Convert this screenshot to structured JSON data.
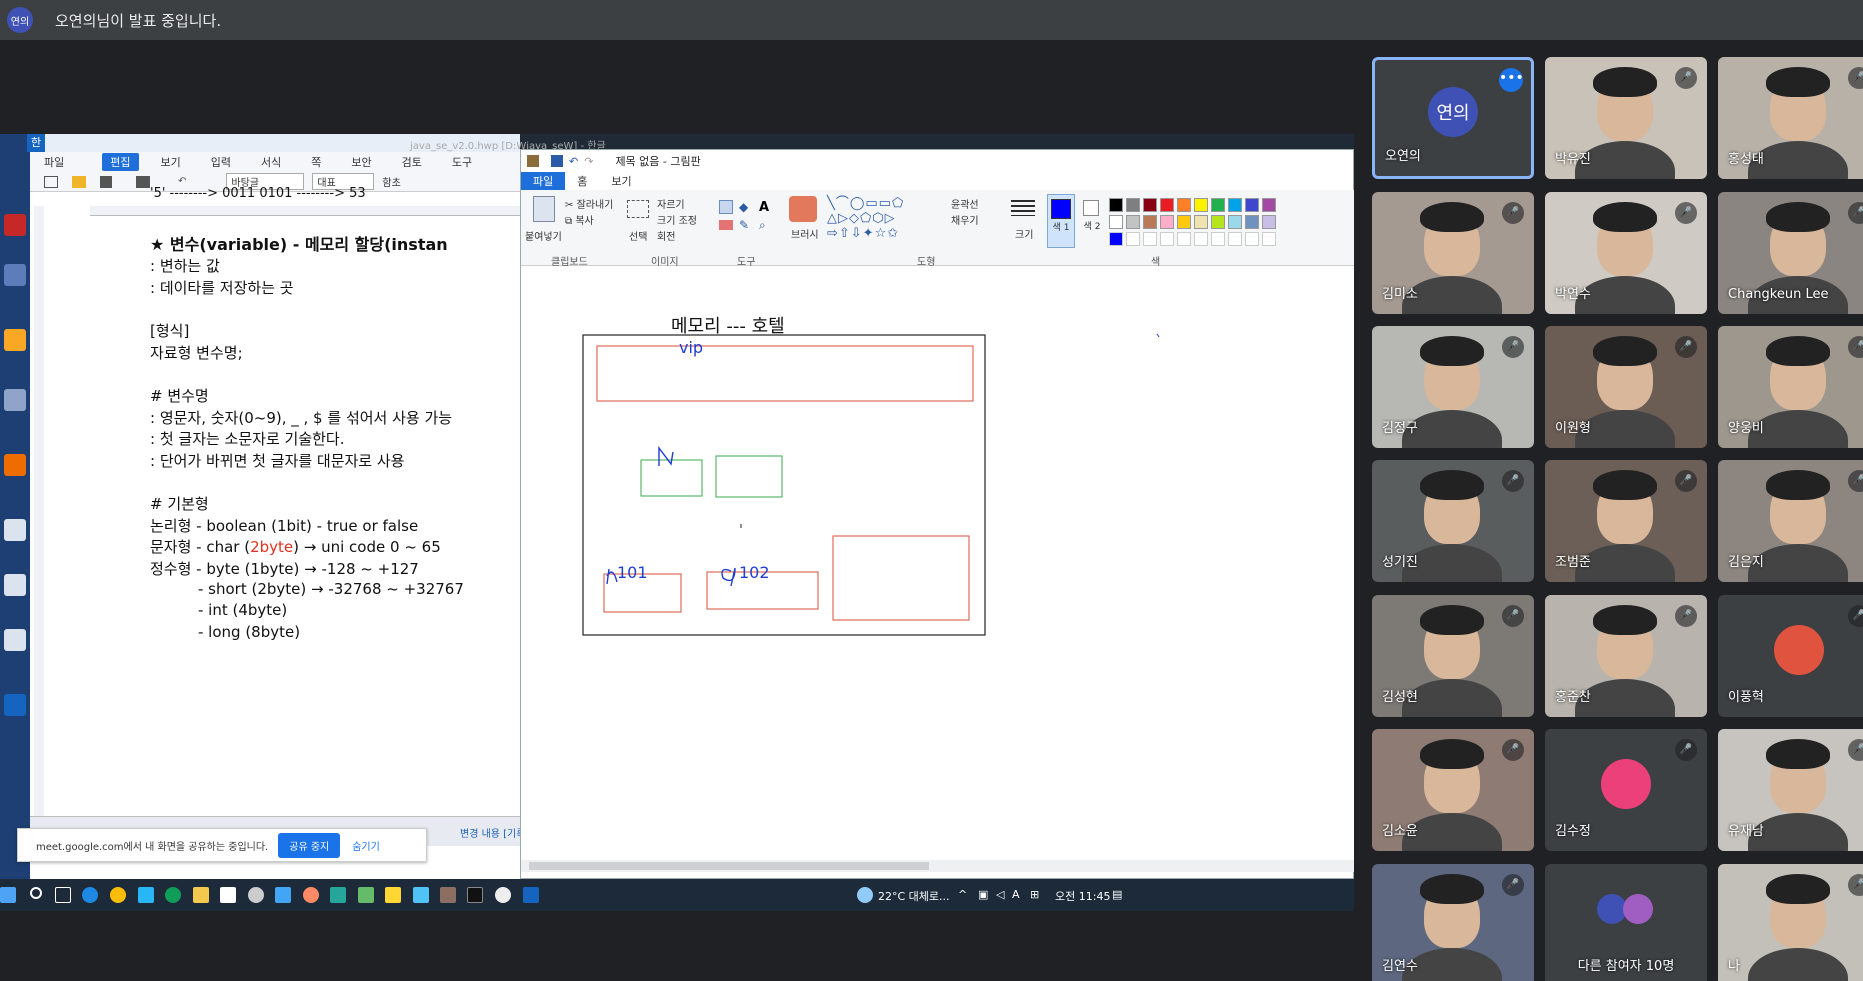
{
  "topbar": {
    "avatar": "연의",
    "message": "오연의님이 발표 중입니다."
  },
  "hwp": {
    "title": "java_se_v2.0.hwp [D:Wjava_seW] - 한글",
    "logo": "한",
    "menu": [
      "파일",
      "편집",
      "보기",
      "입력",
      "서식",
      "쪽",
      "보안",
      "검토",
      "도구"
    ],
    "toolbar": {
      "style": "바탕글",
      "para": "대표",
      "ref": "함초"
    },
    "status": "변경 내용 [기록"
  },
  "doc": {
    "line1": "'5'   -------->   0011  0101   -------->  53",
    "heading": "★ 변수(variable) - 메모리 할당(instan",
    "l_a": ": 변하는 값",
    "l_b": ": 데이타를 저장하는 곳",
    "l_c": "[형식]",
    "l_d": "자료형 변수명;",
    "l_e": "# 변수명",
    "l_f": ": 영문자, 숫자(0~9), _ , $ 를 섞어서 사용 가능",
    "l_g": ": 첫 글자는 소문자로 기술한다.",
    "l_h": ": 단어가 바뀌면 첫 글자를 대문자로 사용",
    "l_i": "# 기본형",
    "l_j": "논리형  -  boolean  (1bit)  -  true  or  false",
    "l_k1": "문자형  -  char  (",
    "l_k2": "2byte",
    "l_k3": ")  →  uni  code     0  ~  65",
    "l_l": "정수형  -  byte   (1byte)  →  -128  ~  +127",
    "l_m": "- short  (2byte)  →  -32768  ~  +32767",
    "l_n": "- int      (4byte)",
    "l_o": "- long     (8byte)"
  },
  "notice": {
    "message": "meet.google.com에서 내 화면을 공유하는 중입니다.",
    "stop": "공유 중지",
    "hide": "숨기기"
  },
  "paint": {
    "title": "제목 없음 - 그림판",
    "tabs": [
      "파일",
      "홈",
      "보기"
    ],
    "clipboard": {
      "paste": "붙여넣기",
      "cut": "잘라내기",
      "copy": "복사",
      "label": "클립보드"
    },
    "image": {
      "select": "선택",
      "crop": "자르기",
      "resize": "크기 조정",
      "rotate": "회전",
      "label": "이미지"
    },
    "tools": {
      "label": "도구",
      "brush": "브러시"
    },
    "shapes": {
      "outline": "윤곽선",
      "fill": "채우기",
      "label": "도형"
    },
    "size": "크기",
    "color1": "색 1",
    "color2": "색 2",
    "colors_label": "색",
    "palette": [
      "#000000",
      "#7f7f7f",
      "#880015",
      "#ed1c24",
      "#ff7f27",
      "#fff200",
      "#22b14c",
      "#00a2e8",
      "#3f48cc",
      "#a349a4",
      "#ffffff",
      "#c3c3c3",
      "#b97a57",
      "#ffaec9",
      "#ffc90e",
      "#efe4b0",
      "#b5e61d",
      "#99d9ea",
      "#7092be",
      "#c8bfe7"
    ],
    "canvas": {
      "heading": "메모리 ---    호텔",
      "vip": "vip",
      "room101": "101",
      "room102": "102"
    }
  },
  "taskbar": {
    "weather": "22°C  대체로...",
    "ime": "A",
    "time": "오전 11:45"
  },
  "participants": [
    {
      "name": "오연의",
      "avatar": "연의",
      "color": "#3f51b5",
      "type": "avatar",
      "active": true
    },
    {
      "name": "박유진",
      "type": "video",
      "bg": "#c9c2b8"
    },
    {
      "name": "홍성태",
      "type": "video",
      "bg": "#b8b1a8"
    },
    {
      "name": "김미소",
      "type": "video",
      "bg": "#a49a92"
    },
    {
      "name": "박연수",
      "type": "video",
      "bg": "#cfcac4"
    },
    {
      "name": "Changkeun Lee",
      "type": "video",
      "bg": "#8a8580"
    },
    {
      "name": "김정구",
      "type": "video",
      "bg": "#b7b8b4"
    },
    {
      "name": "이원형",
      "type": "video",
      "bg": "#6b5d54"
    },
    {
      "name": "양웅비",
      "type": "video",
      "bg": "#9d978e"
    },
    {
      "name": "성기진",
      "type": "video",
      "bg": "#5a5d5e"
    },
    {
      "name": "조범준",
      "type": "video",
      "bg": "#6c5f57"
    },
    {
      "name": "김은지",
      "type": "video",
      "bg": "#8d8680"
    },
    {
      "name": "김성현",
      "type": "video",
      "bg": "#7d7a76"
    },
    {
      "name": "홍준찬",
      "type": "video",
      "bg": "#b8b4ad"
    },
    {
      "name": "이풍혁",
      "type": "avatar",
      "color": "#e0533f",
      "avatar": ""
    },
    {
      "name": "김소윤",
      "type": "video",
      "bg": "#8e7c74"
    },
    {
      "name": "김수정",
      "type": "avatar",
      "color": "#ec407a",
      "avatar": ""
    },
    {
      "name": "유재남",
      "type": "video",
      "bg": "#c7c4bf"
    },
    {
      "name": "김연수",
      "type": "video",
      "bg": "#5d6880"
    },
    {
      "name": "다른 참여자 10명",
      "type": "others"
    },
    {
      "name": "나",
      "type": "video",
      "bg": "#c3c0b9"
    }
  ]
}
